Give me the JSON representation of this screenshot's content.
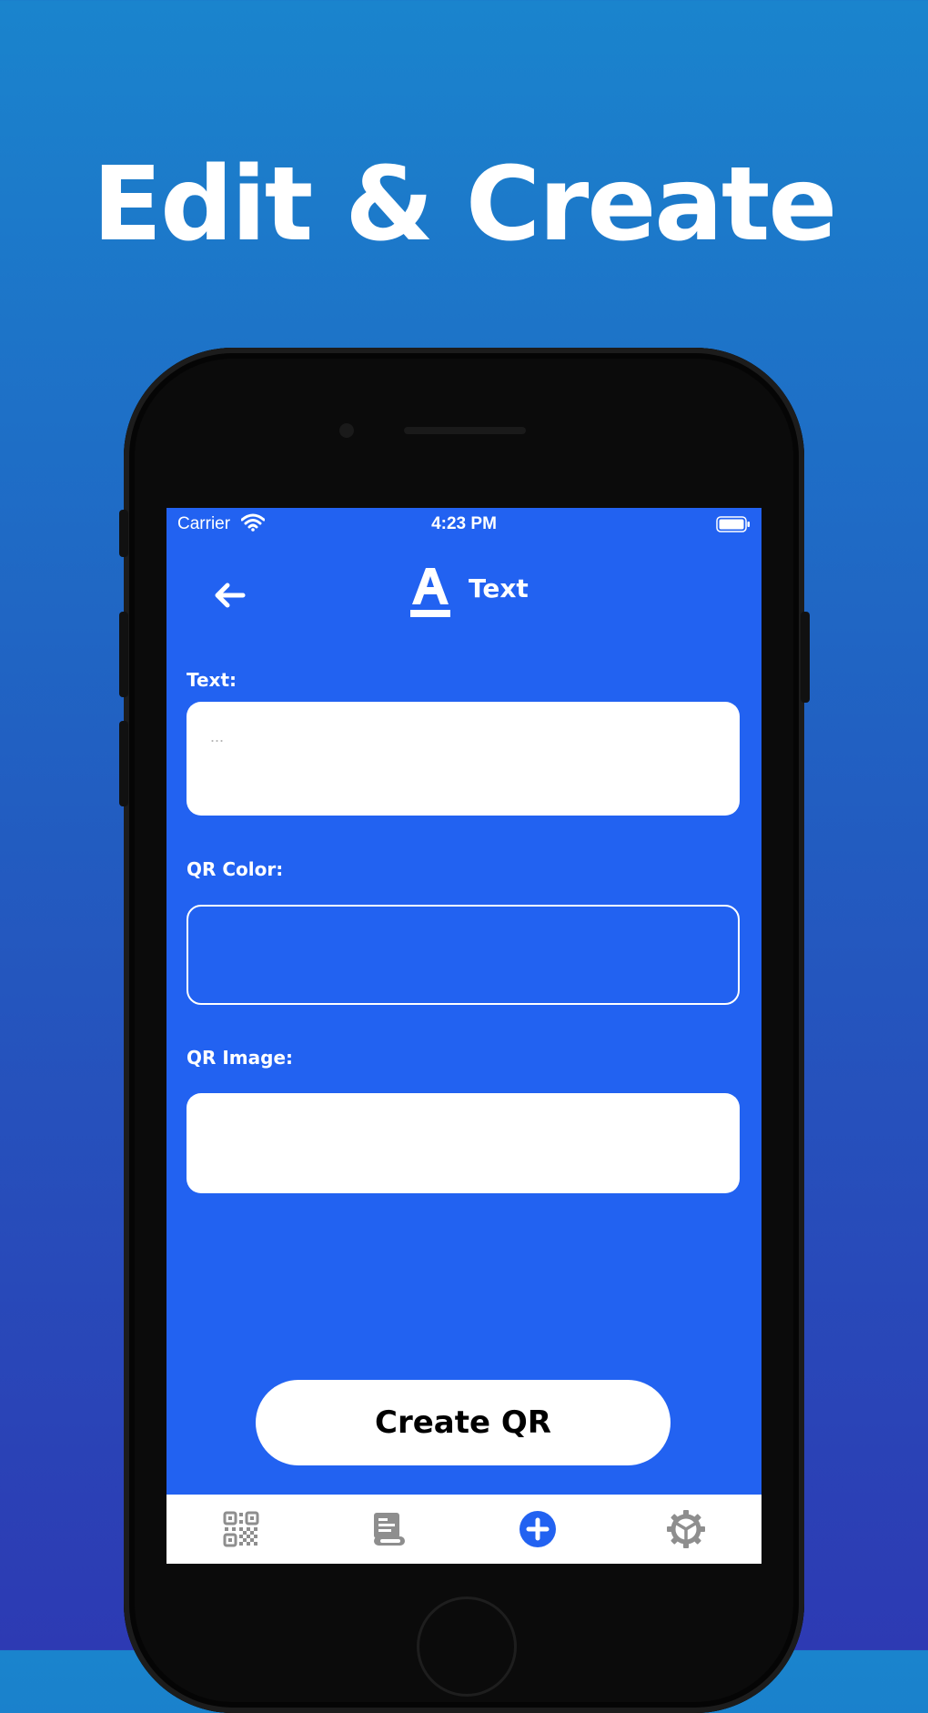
{
  "headline": "Edit & Create",
  "status_bar": {
    "carrier": "Carrier",
    "time": "4:23 PM"
  },
  "nav": {
    "title": "Text",
    "back_icon": "arrow-left-icon",
    "title_icon": "text-format-icon"
  },
  "form": {
    "text_label": "Text:",
    "text_placeholder": "...",
    "color_label": "QR Color:",
    "image_label": "QR Image:"
  },
  "create_button": "Create QR",
  "tabbar": {
    "tabs": [
      {
        "icon": "qr-code-icon",
        "active": false
      },
      {
        "icon": "history-scroll-icon",
        "active": false
      },
      {
        "icon": "add-circle-icon",
        "active": true
      },
      {
        "icon": "settings-gear-icon",
        "active": false
      }
    ]
  },
  "colors": {
    "screen": "#2262f1",
    "accent": "#2262f1",
    "tab_icon": "#8e8e8e"
  }
}
